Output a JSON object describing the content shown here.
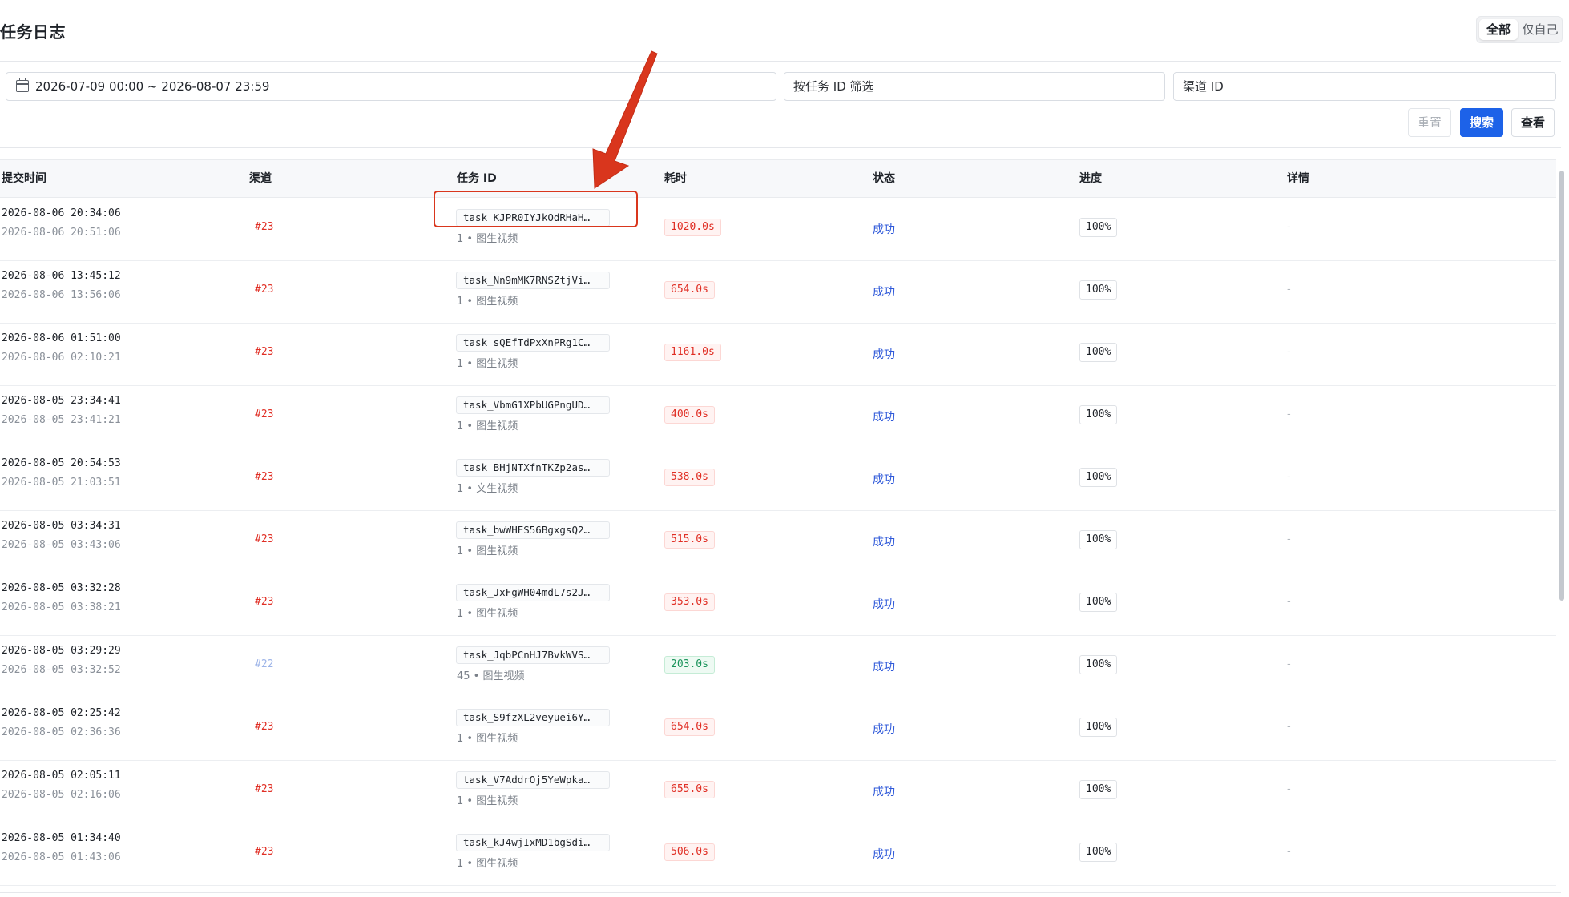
{
  "page": {
    "title": "任务日志"
  },
  "scope_toggle": {
    "all": "全部",
    "mine": "仅自己",
    "selected": "全部"
  },
  "filters": {
    "date_range": "2026-07-09 00:00 ~ 2026-08-07 23:59",
    "task_id_placeholder": "按任务 ID 筛选",
    "channel_placeholder": "渠道 ID",
    "reset_label": "重置",
    "search_label": "搜索",
    "view_label": "查看"
  },
  "table": {
    "headers": {
      "submit_time": "提交时间",
      "channel": "渠道",
      "task_id": "任务 ID",
      "duration": "耗时",
      "status": "状态",
      "progress": "进度",
      "details": "详情"
    },
    "rows": [
      {
        "submit": "2026-08-06 20:34:06",
        "finish": "2026-08-06 20:51:06",
        "channel": "#23",
        "task_id": "task_KJPR0IYJkOdRHaH…",
        "sub": "1 • 图生视频",
        "duration": "1020.0s",
        "dur_color": "red",
        "status": "成功",
        "progress": "100%",
        "detail": "-"
      },
      {
        "submit": "2026-08-06 13:45:12",
        "finish": "2026-08-06 13:56:06",
        "channel": "#23",
        "task_id": "task_Nn9mMK7RNSZtjVi…",
        "sub": "1 • 图生视频",
        "duration": "654.0s",
        "dur_color": "red",
        "status": "成功",
        "progress": "100%",
        "detail": "-"
      },
      {
        "submit": "2026-08-06 01:51:00",
        "finish": "2026-08-06 02:10:21",
        "channel": "#23",
        "task_id": "task_sQEfTdPxXnPRg1C…",
        "sub": "1 • 图生视频",
        "duration": "1161.0s",
        "dur_color": "red",
        "status": "成功",
        "progress": "100%",
        "detail": "-"
      },
      {
        "submit": "2026-08-05 23:34:41",
        "finish": "2026-08-05 23:41:21",
        "channel": "#23",
        "task_id": "task_VbmG1XPbUGPngUD…",
        "sub": "1 • 图生视频",
        "duration": "400.0s",
        "dur_color": "red",
        "status": "成功",
        "progress": "100%",
        "detail": "-"
      },
      {
        "submit": "2026-08-05 20:54:53",
        "finish": "2026-08-05 21:03:51",
        "channel": "#23",
        "task_id": "task_BHjNTXfnTKZp2as…",
        "sub": "1 • 文生视频",
        "duration": "538.0s",
        "dur_color": "red",
        "status": "成功",
        "progress": "100%",
        "detail": "-"
      },
      {
        "submit": "2026-08-05 03:34:31",
        "finish": "2026-08-05 03:43:06",
        "channel": "#23",
        "task_id": "task_bwWHES56BgxgsQ2…",
        "sub": "1 • 图生视频",
        "duration": "515.0s",
        "dur_color": "red",
        "status": "成功",
        "progress": "100%",
        "detail": "-"
      },
      {
        "submit": "2026-08-05 03:32:28",
        "finish": "2026-08-05 03:38:21",
        "channel": "#23",
        "task_id": "task_JxFgWH04mdL7s2J…",
        "sub": "1 • 图生视频",
        "duration": "353.0s",
        "dur_color": "red",
        "status": "成功",
        "progress": "100%",
        "detail": "-"
      },
      {
        "submit": "2026-08-05 03:29:29",
        "finish": "2026-08-05 03:32:52",
        "channel": "#22",
        "task_id": "task_JqbPCnHJ7BvkWVS…",
        "sub": "45 • 图生视频",
        "duration": "203.0s",
        "dur_color": "green",
        "status": "成功",
        "progress": "100%",
        "detail": "-"
      },
      {
        "submit": "2026-08-05 02:25:42",
        "finish": "2026-08-05 02:36:36",
        "channel": "#23",
        "task_id": "task_S9fzXL2veyuei6Y…",
        "sub": "1 • 图生视频",
        "duration": "654.0s",
        "dur_color": "red",
        "status": "成功",
        "progress": "100%",
        "detail": "-"
      },
      {
        "submit": "2026-08-05 02:05:11",
        "finish": "2026-08-05 02:16:06",
        "channel": "#23",
        "task_id": "task_V7AddrOj5YeWpka…",
        "sub": "1 • 图生视频",
        "duration": "655.0s",
        "dur_color": "red",
        "status": "成功",
        "progress": "100%",
        "detail": "-"
      },
      {
        "submit": "2026-08-05 01:34:40",
        "finish": "2026-08-05 01:43:06",
        "channel": "#23",
        "task_id": "task_kJ4wjIxMD1bgSdi…",
        "sub": "1 • 图生视频",
        "duration": "506.0s",
        "dur_color": "red",
        "status": "成功",
        "progress": "100%",
        "detail": "-"
      }
    ]
  },
  "colors": {
    "primary": "#1d62e8",
    "danger": "#e02e24",
    "success": "#19935a",
    "link": "#2f59d9",
    "annotation": "#d9361d"
  },
  "icons": {
    "date": "calendar-icon"
  }
}
